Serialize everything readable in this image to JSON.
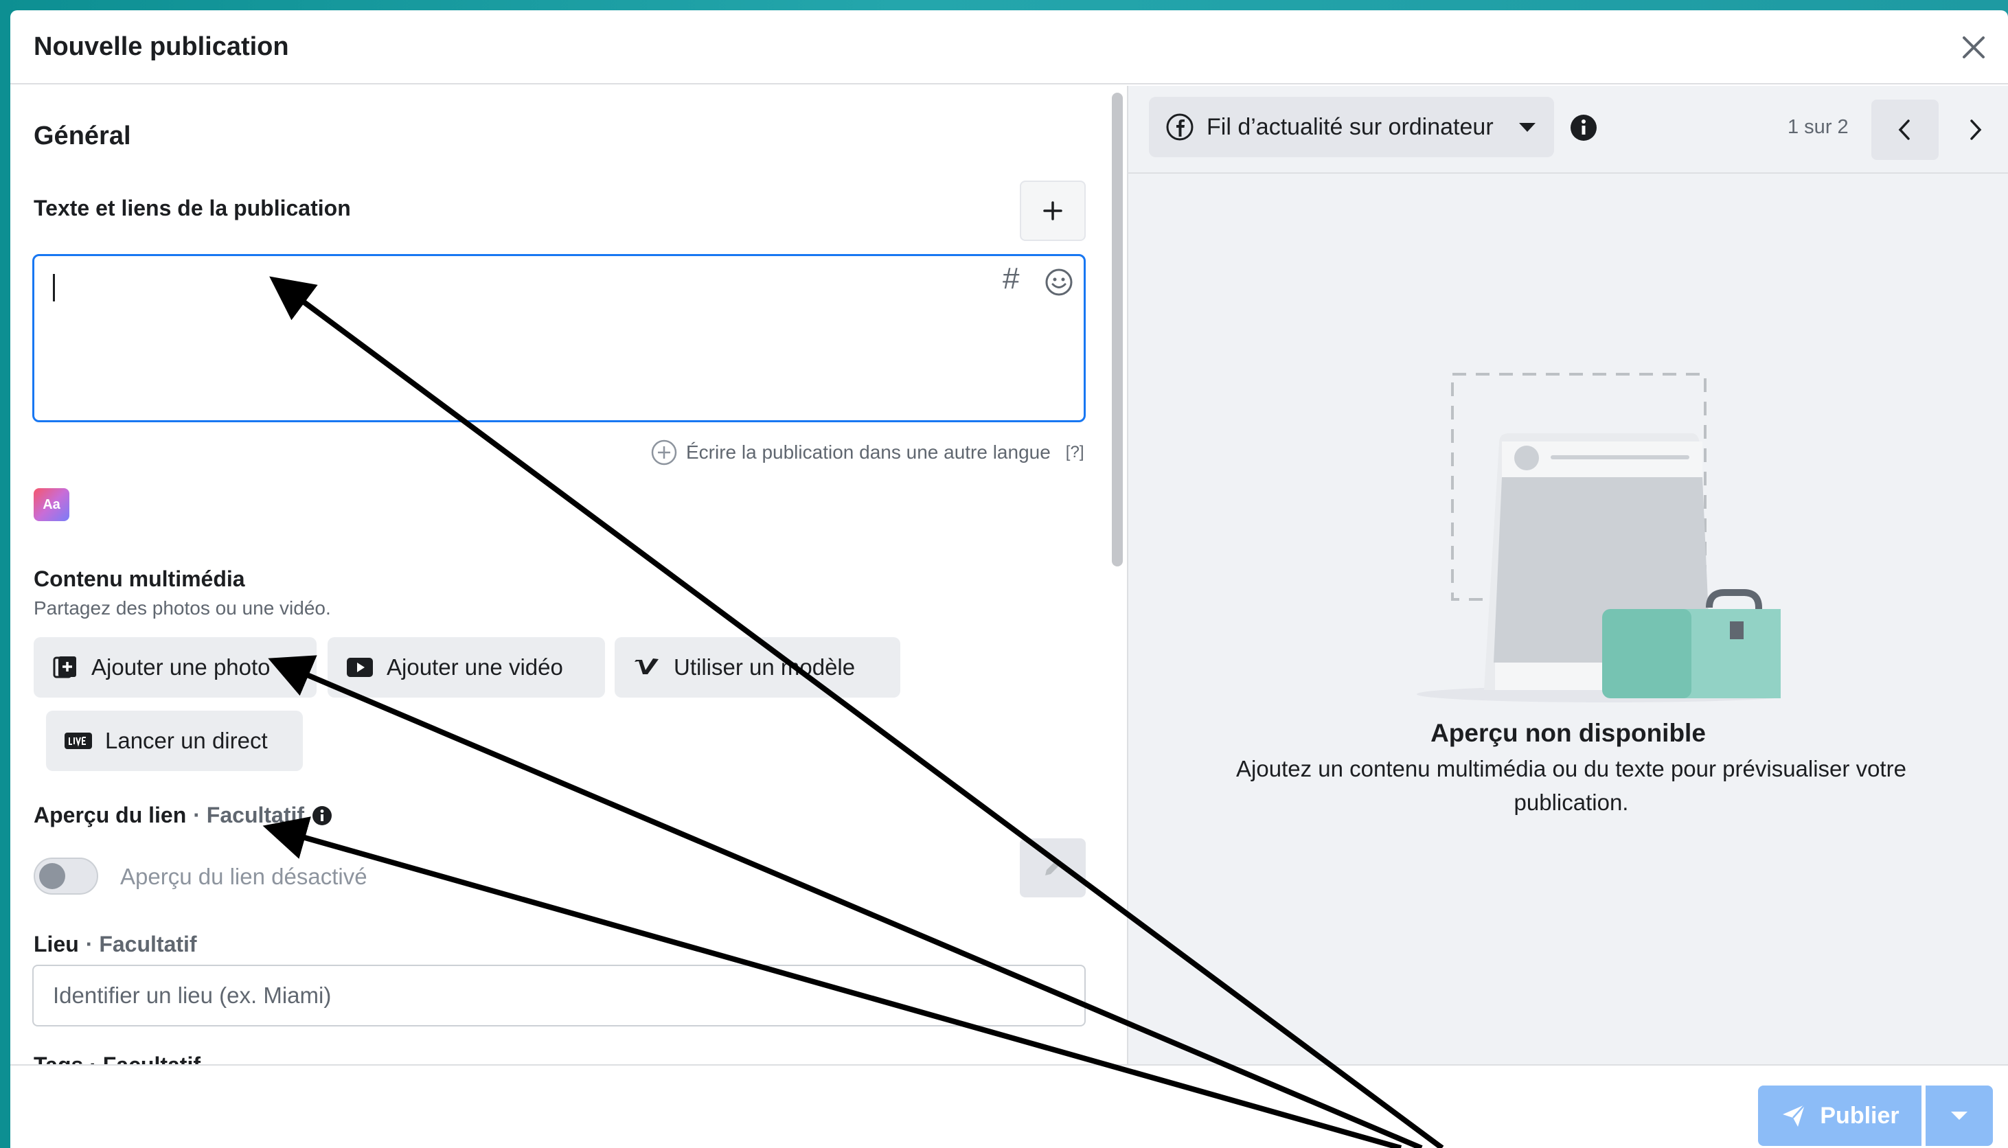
{
  "dialog": {
    "title": "Nouvelle publication"
  },
  "left": {
    "section_title": "Général",
    "text_label": "Texte et liens de la publication",
    "text_value": "",
    "other_language": "Écrire la publication dans une autre langue",
    "other_language_help": "[?]",
    "ab_badge": "Aa",
    "media_title": "Contenu multimédia",
    "media_subtitle": "Partagez des photos ou une vidéo.",
    "buttons": {
      "add_photo": "Ajouter une photo",
      "add_video": "Ajouter une vidéo",
      "use_template": "Utiliser un modèle",
      "go_live": "Lancer un direct"
    },
    "link_preview_label": "Aperçu du lien",
    "link_preview_optional": "· Facultatif",
    "link_preview_toggle": "Aperçu du lien désactivé",
    "link_preview_enabled": false,
    "location_label": "Lieu",
    "location_optional": "· Facultatif",
    "location_placeholder": "Identifier un lieu (ex. Miami)",
    "cut_label": "Tags · Facultatif"
  },
  "right": {
    "placement": "Fil d’actualité sur ordinateur",
    "pager": "1 sur 2",
    "preview_title": "Aperçu non disponible",
    "preview_desc": "Ajoutez un contenu multimédia ou du texte pour prévisualiser votre publication."
  },
  "footer": {
    "publish": "Publier"
  },
  "colors": {
    "accent": "#1877f2",
    "publish_disabled": "#8cbcf7",
    "backdrop": "#1e9aa2",
    "panel_bg": "#f0f2f5",
    "illustration_green": "#7cc7b5"
  },
  "icons": [
    "close-icon",
    "plus-icon",
    "hashtag-icon",
    "emoji-icon",
    "add-circle-icon",
    "photo-icon",
    "video-icon",
    "vimeo-icon",
    "live-icon",
    "info-icon",
    "pencil-icon",
    "facebook-icon",
    "caret-down-icon",
    "chevron-left-icon",
    "chevron-right-icon",
    "send-icon"
  ]
}
